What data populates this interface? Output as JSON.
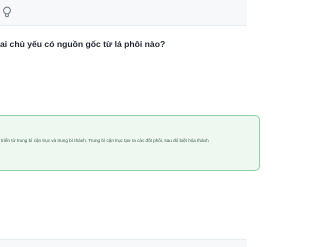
{
  "header": {
    "icon": "lightbulb-icon"
  },
  "question": {
    "text": "ai chủ yếu có nguồn gốc từ lá phôi nào?"
  },
  "answer": {
    "text": "triển từ trung bì cận trục và trung bì thành. Trung bì cận trục tạo ra các đốt phôi, sau đó biệt hóa thành",
    "accent_color": "#8fd0a6",
    "background_color": "#eef8f1"
  }
}
